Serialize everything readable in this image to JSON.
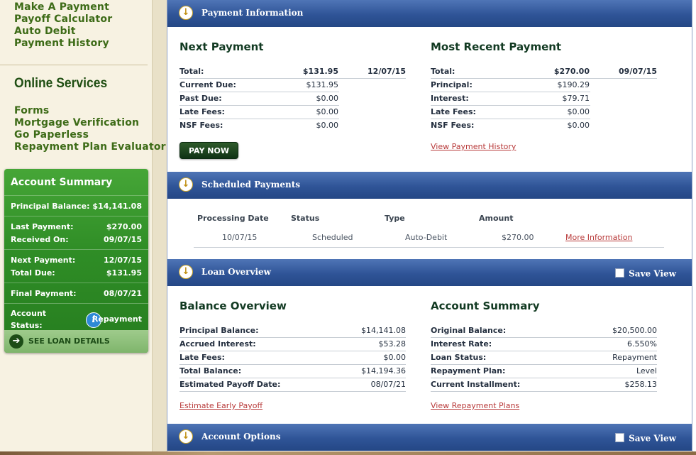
{
  "sidebar": {
    "top_links": [
      "Make A Payment",
      "Payoff Calculator",
      "Auto Debit",
      "Payment History"
    ],
    "online_services_title": "Online Services",
    "service_links": [
      "Forms",
      "Mortgage Verification",
      "Go Paperless",
      "Repayment Plan Evaluator"
    ],
    "account_summary": {
      "title": "Account Summary",
      "principal_balance_label": "Principal Balance:",
      "principal_balance": "$14,141.08",
      "last_payment_label": "Last Payment:",
      "last_payment": "$270.00",
      "received_on_label": "Received On:",
      "received_on": "09/07/15",
      "next_payment_label": "Next Payment:",
      "next_payment": "12/07/15",
      "total_due_label": "Total Due:",
      "total_due": "$131.95",
      "final_payment_label": "Final Payment:",
      "final_payment": "08/07/21",
      "account_label": "Account",
      "status_label": "Status:",
      "status_value": "Repayment",
      "info_glyph": "i",
      "see_details_label": "SEE LOAN DETAILS",
      "see_details_glyph": "➔"
    }
  },
  "payment_info": {
    "header": "Payment Information",
    "next_payment": {
      "title": "Next Payment",
      "rows": [
        {
          "label": "Total:",
          "value": "$131.95",
          "date": "12/07/15"
        },
        {
          "label": "Current Due:",
          "value": "$131.95"
        },
        {
          "label": "Past Due:",
          "value": "$0.00"
        },
        {
          "label": "Late Fees:",
          "value": "$0.00"
        },
        {
          "label": "NSF Fees:",
          "value": "$0.00"
        }
      ],
      "pay_now": "PAY NOW"
    },
    "recent_payment": {
      "title": "Most Recent Payment",
      "rows": [
        {
          "label": "Total:",
          "value": "$270.00",
          "date": "09/07/15"
        },
        {
          "label": "Principal:",
          "value": "$190.29"
        },
        {
          "label": "Interest:",
          "value": "$79.71"
        },
        {
          "label": "Late Fees:",
          "value": "$0.00"
        },
        {
          "label": "NSF Fees:",
          "value": "$0.00"
        }
      ],
      "history_link": "View Payment History"
    }
  },
  "scheduled": {
    "header": "Scheduled Payments",
    "columns": [
      "Processing Date",
      "Status",
      "Type",
      "Amount"
    ],
    "row": {
      "date": "10/07/15",
      "status": "Scheduled",
      "type": "Auto-Debit",
      "amount": "$270.00",
      "link": "More Information"
    }
  },
  "loan_overview": {
    "header": "Loan Overview",
    "save_view": "Save View",
    "balance": {
      "title": "Balance Overview",
      "rows": [
        {
          "label": "Principal Balance:",
          "value": "$14,141.08"
        },
        {
          "label": "Accrued Interest:",
          "value": "$53.28"
        },
        {
          "label": "Late Fees:",
          "value": "$0.00"
        },
        {
          "label": "Total Balance:",
          "value": "$14,194.36"
        },
        {
          "label": "Estimated Payoff Date:",
          "value": "08/07/21"
        }
      ],
      "link": "Estimate Early Payoff"
    },
    "summary": {
      "title": "Account Summary",
      "rows": [
        {
          "label": "Original Balance:",
          "value": "$20,500.00"
        },
        {
          "label": "Interest Rate:",
          "value": "6.550%"
        },
        {
          "label": "Loan Status:",
          "value": "Repayment"
        },
        {
          "label": "Repayment Plan:",
          "value": "Level"
        },
        {
          "label": "Current Installment:",
          "value": "$258.13"
        }
      ],
      "link": "View Repayment Plans"
    }
  },
  "account_options": {
    "header": "Account Options",
    "save_view": "Save View"
  }
}
